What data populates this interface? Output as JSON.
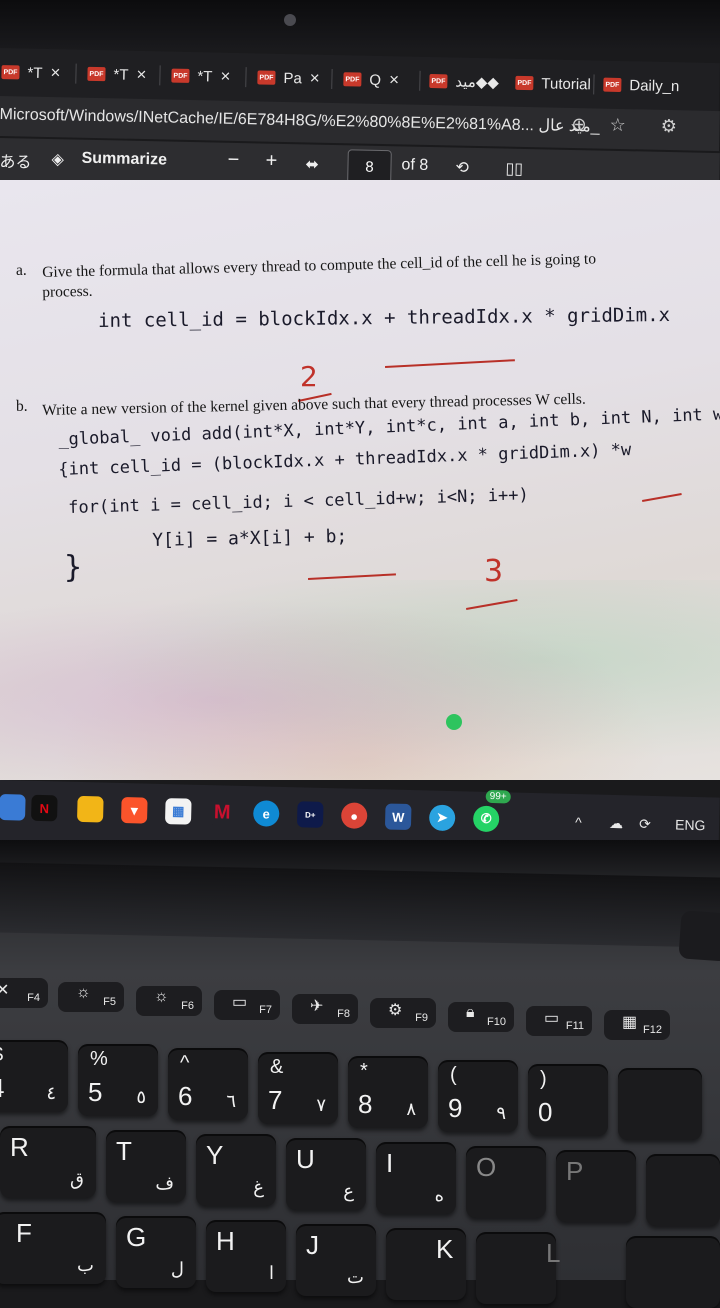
{
  "browser": {
    "tabs": [
      {
        "label": "*T",
        "close": "×"
      },
      {
        "label": "*T",
        "close": "×"
      },
      {
        "label": "*T",
        "close": "×"
      },
      {
        "label": "Pa",
        "close": "×"
      },
      {
        "label": "Q",
        "close": "×"
      },
      {
        "label": "ميد◆◆",
        "close": ""
      },
      {
        "label": "Tutorial",
        "close": ""
      },
      {
        "label": "Daily_n",
        "close": ""
      }
    ],
    "pdf_icon_text": "PDF",
    "url": "Microsoft/Windows/INetCache/IE/6E784H8G/%E2%80%8E%E2%81%A8... ميد عال_",
    "url_icons": [
      "zoom-icon",
      "star-icon",
      "settings-icon"
    ]
  },
  "pdf_toolbar": {
    "summarize": "Summarize",
    "minus": "−",
    "plus": "+",
    "page_current": "8",
    "page_total": "of 8"
  },
  "document": {
    "question_a_letter": "a.",
    "question_a_line1": "Give the formula that allows every thread to compute the cell_id of the cell he is going to",
    "question_a_line2": "process.",
    "answer_a": "int  cell_id = blockIdx.x + threadIdx.x * gridDim.x",
    "mark_a": "2",
    "question_b_letter": "b.",
    "question_b": "Write a new version of the kernel given above such that every thread processes W cells.",
    "answer_b_lines": [
      "_global_ void add(int*X, int*Y, int*c, int a, int b, int N, int w)",
      "{int cell_id = (blockIdx.x + threadIdx.x * gridDim.x) *w",
      "for(int i = cell_id; i < cell_id+w; i<N; i++)",
      "Y[i] = a*X[i] + b;",
      "}"
    ],
    "mark_b": "3"
  },
  "taskbar": {
    "badge": "99+",
    "lang": "ENG",
    "icons": [
      "netflix-icon",
      "files-icon",
      "brave-icon",
      "store-icon",
      "mcafee-icon",
      "edge-icon",
      "disney-icon",
      "chrome-icon",
      "word-icon",
      "telegram-icon",
      "whatsapp-icon"
    ]
  },
  "keyboard": {
    "fkeys": [
      "F4",
      "F5",
      "F6",
      "F7",
      "F8",
      "F9",
      "F10",
      "F11",
      "F12"
    ],
    "row_numbers": [
      {
        "top": "$",
        "main": "4",
        "ar": "٤"
      },
      {
        "top": "%",
        "main": "5",
        "ar": "٥"
      },
      {
        "top": "^",
        "main": "6",
        "ar": "٦"
      },
      {
        "top": "&",
        "main": "7",
        "ar": "٧"
      },
      {
        "top": "*",
        "main": "8",
        "ar": "٨"
      },
      {
        "top": "(",
        "main": "9",
        "ar": "٩"
      },
      {
        "top": ")",
        "main": "0",
        "ar": ""
      }
    ],
    "row_letters": [
      {
        "main": "R",
        "ar": "ق"
      },
      {
        "main": "T",
        "ar": "ف"
      },
      {
        "main": "Y",
        "ar": "غ"
      },
      {
        "main": "U",
        "ar": "ع"
      },
      {
        "main": "I",
        "ar": "ه"
      },
      {
        "main": "O",
        "ar": ""
      },
      {
        "main": "P",
        "ar": ""
      }
    ],
    "row_home": [
      {
        "main": "F",
        "ar": "ب"
      },
      {
        "main": "G",
        "ar": "ل"
      },
      {
        "main": "H",
        "ar": "ا"
      },
      {
        "main": "J",
        "ar": "ت"
      },
      {
        "main": "K",
        "ar": ""
      },
      {
        "main": "L",
        "ar": ""
      }
    ]
  }
}
